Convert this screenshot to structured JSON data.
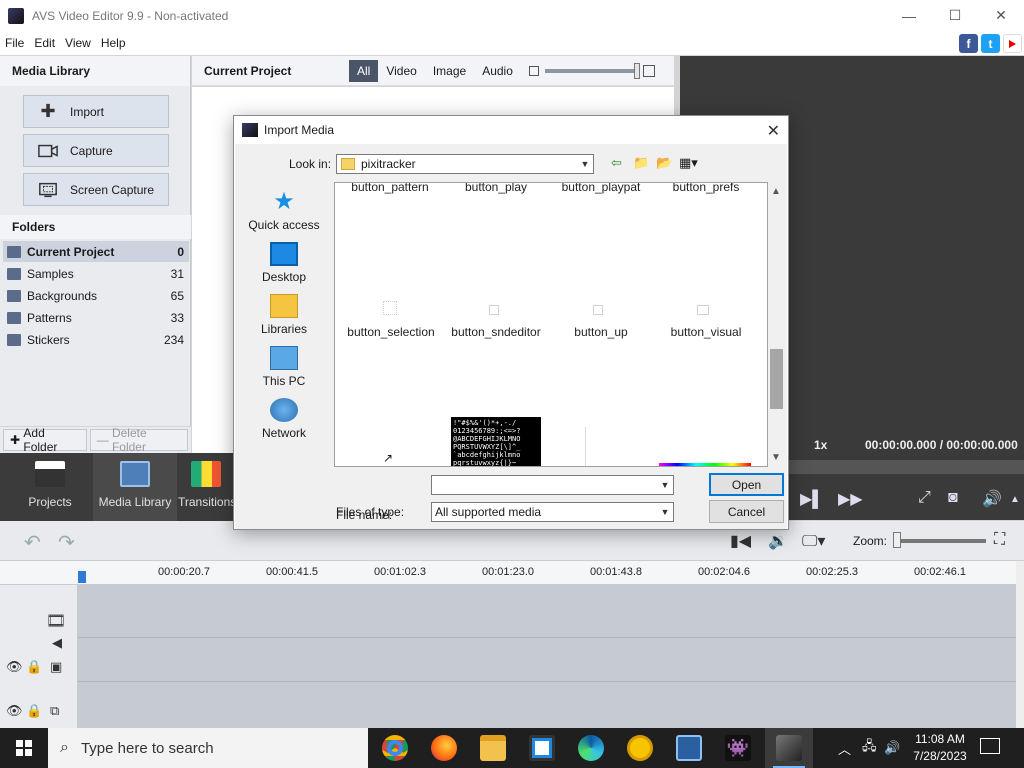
{
  "window": {
    "title": "AVS Video Editor 9.9 - Non-activated",
    "controls": [
      "—",
      "☐",
      "✕"
    ]
  },
  "menu": [
    "File",
    "Edit",
    "View",
    "Help"
  ],
  "social": {
    "facebook": "f",
    "twitter": "t",
    "youtube": ""
  },
  "media_library": {
    "title": "Media Library",
    "buttons": [
      {
        "label": "Import",
        "icon": "plus-icon"
      },
      {
        "label": "Capture",
        "icon": "camera-icon"
      },
      {
        "label": "Screen Capture",
        "icon": "screen-capture-icon"
      }
    ],
    "folders_title": "Folders",
    "folders": [
      {
        "name": "Current Project",
        "count": "0",
        "selected": true
      },
      {
        "name": "Samples",
        "count": "31"
      },
      {
        "name": "Backgrounds",
        "count": "65"
      },
      {
        "name": "Patterns",
        "count": "33"
      },
      {
        "name": "Stickers",
        "count": "234"
      }
    ],
    "add_folder": "Add Folder",
    "delete_folder": "Delete Folder"
  },
  "current_project": {
    "title": "Current Project",
    "filters": [
      "All",
      "Video",
      "Image",
      "Audio"
    ],
    "active_filter": "All"
  },
  "preview": {
    "speed": "1x",
    "time": "00:00:00.000  /  00:00:00.000"
  },
  "tabs": [
    {
      "label": "Projects",
      "icon": "film-clapper-icon"
    },
    {
      "label": "Media Library",
      "icon": "media-library-icon",
      "selected": true
    },
    {
      "label": "Transitions",
      "icon": "transitions-icon"
    }
  ],
  "timeline": {
    "zoom_label": "Zoom:",
    "ticks": [
      "00:00:20.7",
      "00:00:41.5",
      "00:01:02.3",
      "00:01:23.0",
      "00:01:43.8",
      "00:02:04.6",
      "00:02:25.3",
      "00:02:46.1"
    ]
  },
  "dialog": {
    "title": "Import Media",
    "look_in_label": "Look in:",
    "look_in_value": "pixitracker",
    "places": [
      "Quick access",
      "Desktop",
      "Libraries",
      "This PC",
      "Network"
    ],
    "files_row1": [
      "button_pattern",
      "button_play",
      "button_playpat",
      "button_prefs"
    ],
    "files_row2": [
      "button_selection",
      "button_sndeditor",
      "button_up",
      "button_visual"
    ],
    "charset_text": "!\"#$%&'()*+,-./\n0123456789:;<=>?\n@ABCDEFGHIJKLMNO\nPQRSTUVWXYZ[\\]^_\n`abcdefghijklmno\npqrstuvwxyz{|}~",
    "file_name_label": "File name:",
    "file_name_value": "",
    "files_of_type_label": "Files of type:",
    "files_of_type_value": "All supported media",
    "open": "Open",
    "cancel": "Cancel"
  },
  "taskbar": {
    "search_placeholder": "Type here to search",
    "time": "11:08 AM",
    "date": "7/28/2023"
  }
}
